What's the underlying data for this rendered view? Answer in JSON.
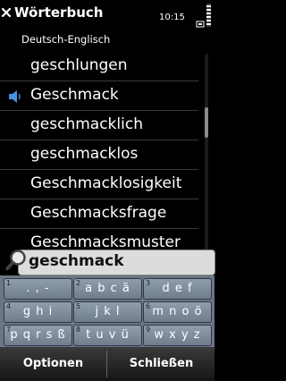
{
  "header": {
    "title": "Wörterbuch",
    "time": "10:15",
    "subtitle": "Deutsch-Englisch"
  },
  "list": {
    "items": [
      {
        "word": "geschlungen",
        "speaker": false
      },
      {
        "word": "Geschmack",
        "speaker": true
      },
      {
        "word": "geschmacklich",
        "speaker": false
      },
      {
        "word": "geschmacklos",
        "speaker": false
      },
      {
        "word": "Geschmacklosigkeit",
        "speaker": false
      },
      {
        "word": "Geschmacksfrage",
        "speaker": false
      },
      {
        "word": "Geschmacksmuster",
        "speaker": false
      }
    ]
  },
  "search": {
    "value": "geschmack",
    "icon": "magnifier-icon"
  },
  "keypad": {
    "keys": [
      {
        "num": "1",
        "chars": ". , -"
      },
      {
        "num": "2",
        "chars": "a b c ä"
      },
      {
        "num": "3",
        "chars": "d e f"
      },
      {
        "num": "4",
        "chars": "g h i"
      },
      {
        "num": "5",
        "chars": "j k l"
      },
      {
        "num": "6",
        "chars": "m n o ö"
      },
      {
        "num": "7",
        "chars": "p q r s ß"
      },
      {
        "num": "8",
        "chars": "t u v ü"
      },
      {
        "num": "9",
        "chars": "w x y z"
      }
    ]
  },
  "softkeys": {
    "left": "Optionen",
    "right": "Schließen"
  },
  "colors": {
    "background": "#000000",
    "keypad": "#6b7685",
    "search_field": "#dcdcdc"
  }
}
